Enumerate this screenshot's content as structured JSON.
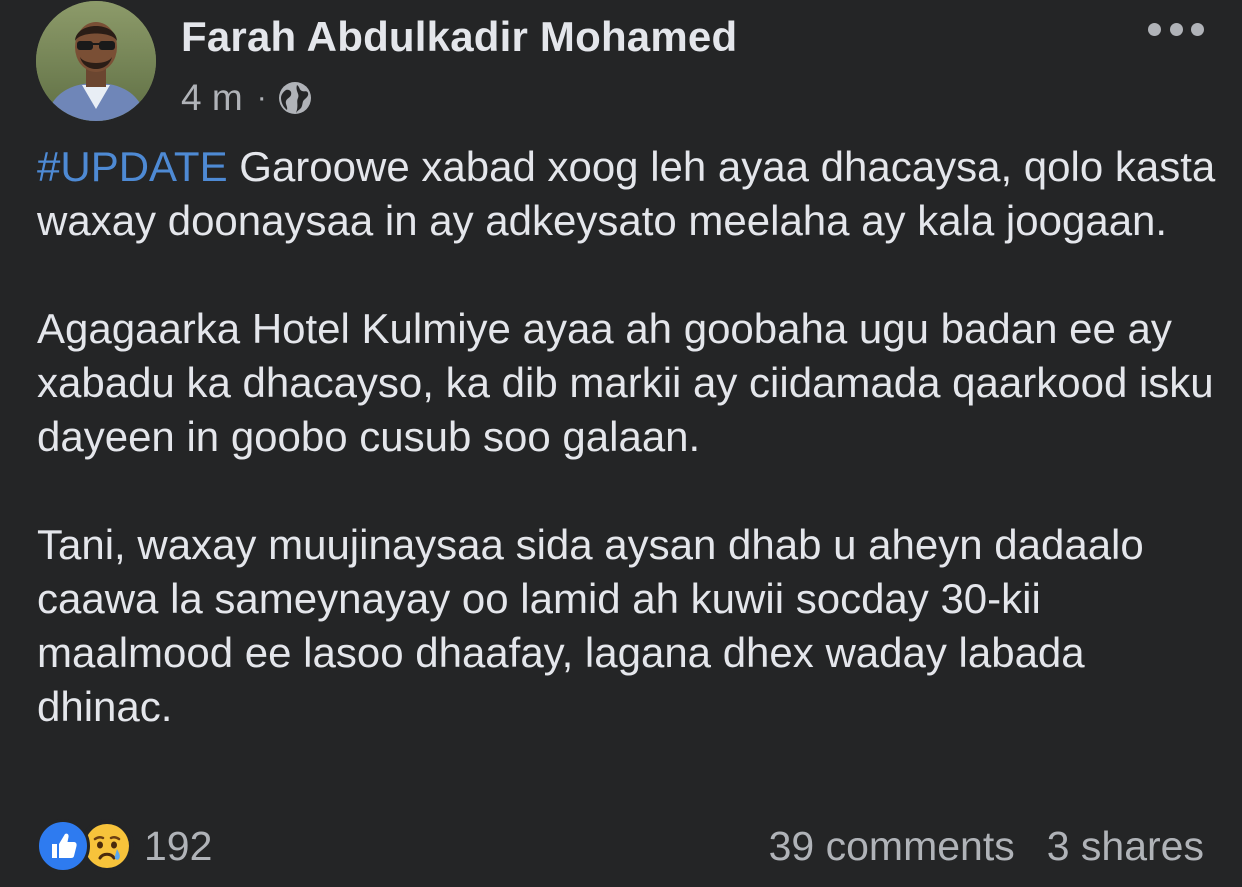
{
  "post": {
    "author": {
      "name": "Farah Abdulkadir Mohamed",
      "avatar_icon": "profile-photo"
    },
    "meta": {
      "time": "4 m",
      "separator": "·",
      "privacy_icon": "globe-icon"
    },
    "more_icon": "more-horizontal-icon",
    "hashtag": "#UPDATE",
    "paragraphs": [
      " Garoowe xabad xoog leh ayaa dhacaysa, qolo kasta waxay doonaysaa in ay adkeysato meelaha ay kala joogaan.",
      "Agagaarka Hotel Kulmiye ayaa ah goobaha ugu badan ee ay xabadu ka dhacayso, ka dib markii ay ciidamada qaarkood isku dayeen in goobo cusub soo galaan.",
      "Tani, waxay muujinaysaa sida aysan dhab u aheyn dadaalo caawa la sameynayay oo lamid ah kuwii socday 30-kii maalmood ee lasoo dhaafay, lagana dhex waday labada dhinac."
    ],
    "footer": {
      "reaction_icons": [
        "like-icon",
        "sad-icon"
      ],
      "reaction_count": "192",
      "comments": "39 comments",
      "shares": "3 shares"
    },
    "colors": {
      "background": "#242526",
      "text": "#e4e6eb",
      "secondary_text": "#b0b3b8",
      "hashtag": "#4e8ad4",
      "like_blue": "#2e7bf0",
      "sad_yellow": "#f7c33b"
    }
  }
}
